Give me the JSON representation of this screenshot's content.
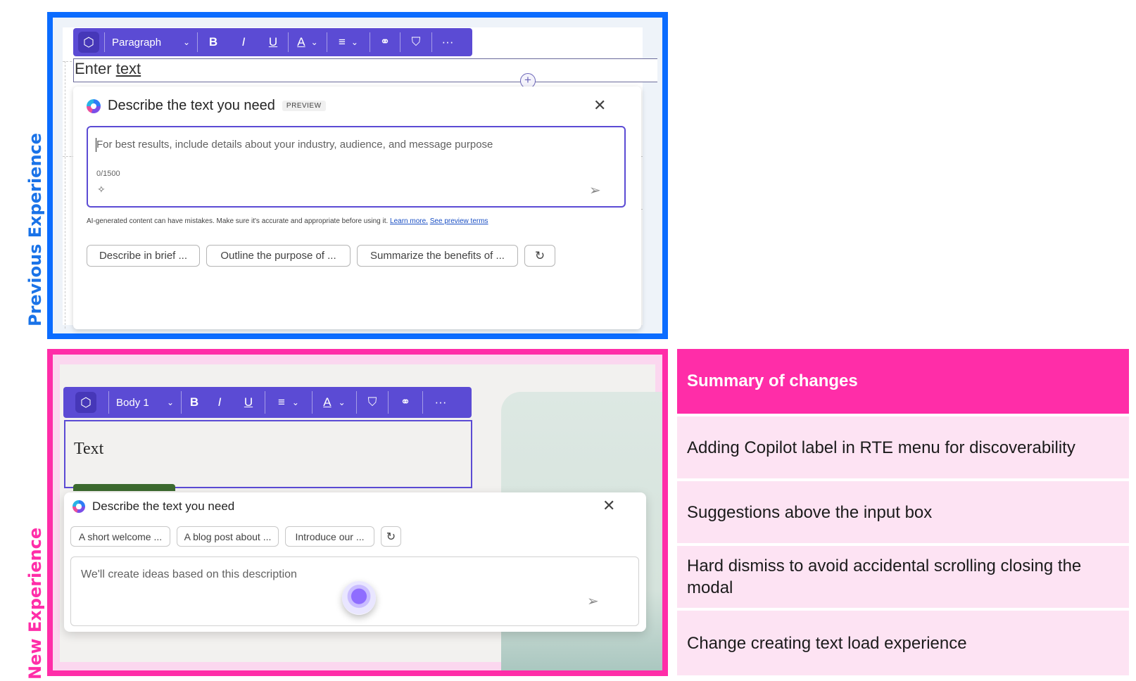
{
  "colors": {
    "previous_accent": "#0b6cff",
    "new_accent": "#ff2da8",
    "toolbar": "#5b4bd4",
    "summary_header": "#ff2da8",
    "summary_row": "#fde3f3"
  },
  "labels": {
    "previous": "Previous Experience",
    "new": "New Experience"
  },
  "previous": {
    "toolbar": {
      "copilot_icon": "copilot-hex-icon",
      "style_dropdown": "Paragraph",
      "bold": "B",
      "italic": "I",
      "underline": "U",
      "font_color": "A",
      "align_icon": "align-icon",
      "link_icon": "link-icon",
      "format_painter_icon": "format-painter-icon",
      "more": "···"
    },
    "editor": {
      "text_part1": "Enter ",
      "text_part2": "text",
      "plus": "+"
    },
    "dialog": {
      "title": "Describe the text you need",
      "badge": "PREVIEW",
      "close": "✕",
      "placeholder": "For best results, include details about your industry, audience, and message purpose",
      "char_count": "0/1500",
      "disclaimer": "AI-generated content can have mistakes. Make sure it's accurate and appropriate before using it.",
      "learn_more": "Learn more.",
      "preview_terms": "See preview terms",
      "suggestions": [
        "Describe in brief ...",
        "Outline the purpose of ...",
        "Summarize the benefits of ..."
      ],
      "refresh": "↻"
    }
  },
  "new": {
    "toolbar": {
      "copilot_icon": "copilot-hex-icon",
      "style_dropdown": "Body 1",
      "bold": "B",
      "italic": "I",
      "underline": "U",
      "font_color": "A",
      "align_icon": "align-icon",
      "link_icon": "link-icon",
      "format_painter_icon": "format-painter-icon",
      "more": "···"
    },
    "editor": {
      "text": "Text"
    },
    "dialog": {
      "title": "Describe the text you need",
      "close": "✕",
      "suggestions": [
        "A short welcome ...",
        "A blog post about ...",
        "Introduce our ..."
      ],
      "refresh": "↻",
      "placeholder": "We'll create ideas based on this description"
    }
  },
  "summary": {
    "header": "Summary of changes",
    "items": [
      "Adding Copilot label in RTE menu for discoverability",
      "Suggestions above the input box",
      "Hard dismiss to avoid accidental scrolling closing the modal",
      "Change creating text load experience"
    ]
  }
}
